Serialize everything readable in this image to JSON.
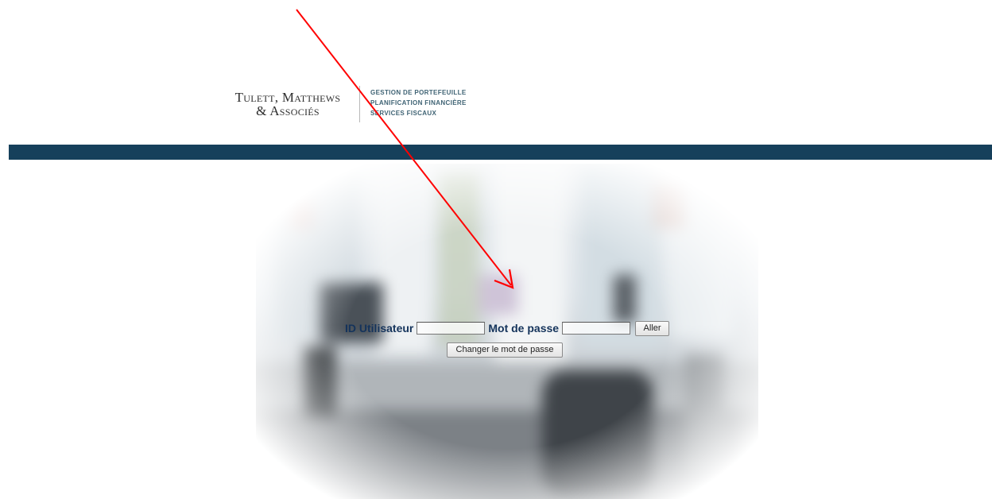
{
  "header": {
    "firm_name_line1": "Tulett, Matthews",
    "firm_name_line2": "& Associés",
    "services": [
      "GESTION DE PORTEFEUILLE",
      "PLANIFICATION FINANCIÈRE",
      "SERVICES FISCAUX"
    ]
  },
  "login": {
    "user_label": "ID Utilisateur",
    "user_value": "",
    "password_label": "Mot de passe",
    "password_value": "",
    "go_button": "Aller",
    "change_password_button": "Changer le mot de passe"
  },
  "colors": {
    "band": "#16405b",
    "label_text": "#14335b",
    "services_text": "#3f6374",
    "annotation_arrow": "#ff0000"
  }
}
